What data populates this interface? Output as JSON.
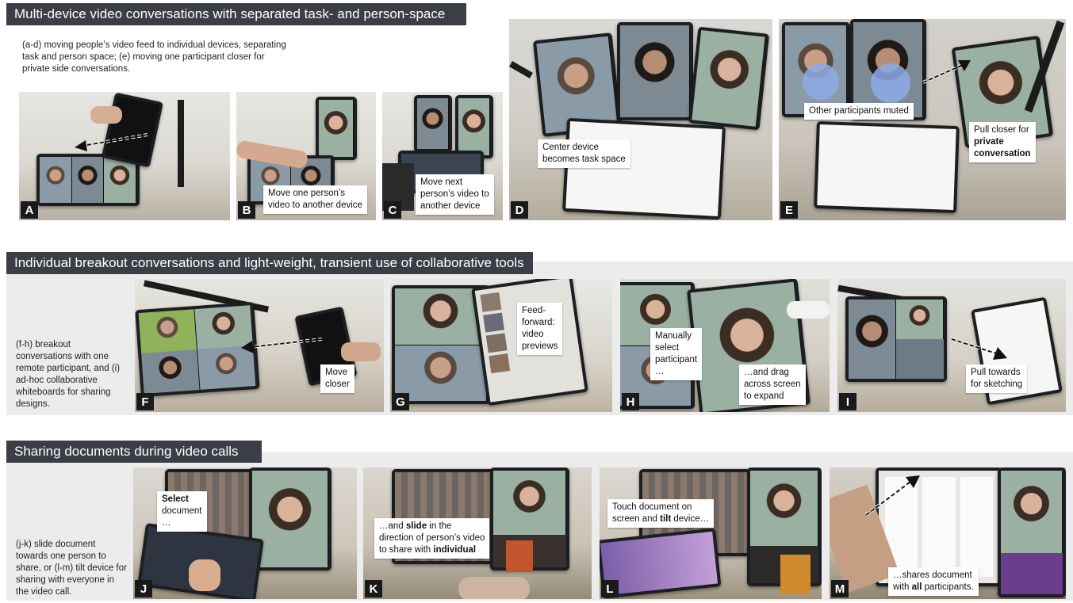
{
  "sections": [
    {
      "title": "Multi-device video conversations with separated task- and person-space",
      "description": "(a-d) moving people’s video feed to individual devices, separating task and person space; (e) moving one participant closer for private side conversations."
    },
    {
      "title": "Individual breakout conversations and light-weight, transient use of collaborative tools",
      "description": "(f-h) breakout conversations with one remote participant, and (i) ad-hoc collaborative whiteboards for sharing designs."
    },
    {
      "title": "Sharing documents during video calls",
      "description": "(j-k) slide document towards one person to share, or (l-m) tilt device for sharing with everyone in the video call."
    }
  ],
  "panels": {
    "A": {
      "letter": "A"
    },
    "B": {
      "letter": "B",
      "caption": [
        "Move one person’s",
        "video to another device"
      ]
    },
    "C": {
      "letter": "C",
      "caption": [
        "Move next",
        "person’s video to",
        "another device"
      ]
    },
    "D": {
      "letter": "D",
      "caption": [
        "Center device",
        "becomes task space"
      ]
    },
    "E": {
      "letter": "E",
      "caption_muted": "Other participants muted",
      "caption_pull": [
        "Pull closer for",
        "private",
        "conversation"
      ]
    },
    "F": {
      "letter": "F",
      "caption": [
        "Move",
        "closer"
      ]
    },
    "G": {
      "letter": "G",
      "caption": [
        "Feed-",
        "forward:",
        "video",
        "previews"
      ]
    },
    "H": {
      "letter": "H",
      "caption_select": [
        "Manually",
        "select",
        "participant",
        "…"
      ],
      "caption_drag": [
        "…and drag",
        "across screen",
        "to expand"
      ]
    },
    "I": {
      "letter": "I",
      "caption": [
        "Pull towards",
        "for sketching"
      ]
    },
    "J": {
      "letter": "J",
      "caption": [
        "Select",
        "document",
        "…"
      ]
    },
    "K": {
      "letter": "K",
      "caption": [
        "…and ",
        "slide",
        " in the",
        "direction of person’s video",
        "to share with ",
        "individual"
      ]
    },
    "L": {
      "letter": "L",
      "caption": [
        "Touch document on",
        "screen and ",
        "tilt",
        " device…"
      ]
    },
    "M": {
      "letter": "M",
      "caption": [
        "…shares document",
        "with ",
        "all",
        " participants."
      ]
    }
  },
  "colors": {
    "header_bg": "#3b3e44",
    "section_bg": "#ececec",
    "label_bg": "#1a1a1a"
  }
}
